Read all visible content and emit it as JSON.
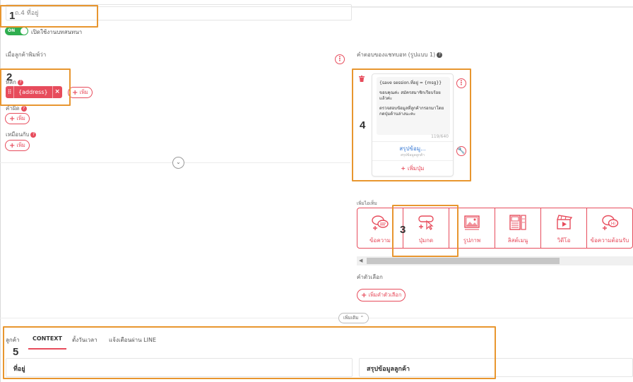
{
  "intent": {
    "name_value": "ถ.4 ที่อยู่",
    "toggle_state": "ON",
    "toggle_label": "เปิดใช้งานบทสนทนา"
  },
  "left": {
    "section_title": "เมื่อลูกค้าพิมพ์ว่า",
    "main_label": "หลัก",
    "chip_text": "{address}",
    "add_label": "เพิ่ม",
    "typo_label": "คำผิด",
    "similar_label": "เหมือนกับ"
  },
  "right": {
    "section_title": "คำตอบของแชทบอท (รูปแบบ 1)",
    "card": {
      "line1": "{save session.ที่อยู่ = {msg}}",
      "line2": "ขอบคุณค่ะ สมัครสมาชิกเรียบร้อยแล้วค่ะ",
      "line3": "ตรวจสอบข้อมูลที่ลูกค้ากรอกมาโดยกดปุ่มด้านล่างนะคะ",
      "counter": "119/640",
      "button_title": "สรุปข้อมู...",
      "button_sub": "สรุปข้อมูลลูกค้า",
      "add_button": "เพิ่มปุ่ม"
    },
    "add_more_label": "เพิ่มไอเท็ม",
    "types": [
      {
        "label": "ข้อความ",
        "icon": "message-icon"
      },
      {
        "label": "ปุ่มกด",
        "icon": "button-cursor-icon"
      },
      {
        "label": "รูปภาพ",
        "icon": "image-icon"
      },
      {
        "label": "ลิสต์เมนู",
        "icon": "list-menu-icon"
      },
      {
        "label": "วิดีโอ",
        "icon": "video-icon"
      },
      {
        "label": "ข้อความต้อนรับ",
        "icon": "greeting-icon"
      }
    ],
    "options_label": "คำตัวเลือก",
    "add_option": "เพิ่มคำตัวเลือก"
  },
  "more_button": "เพิ่มเติม",
  "tabs": {
    "items": [
      "ลูกค้า",
      "CONTEXT",
      "ตั้งวันเวลา",
      "แจ้งเตือนผ่าน LINE"
    ],
    "active_index": 1
  },
  "fields": {
    "address": "ที่อยู่",
    "summary": "สรุปข้อมูลลูกค้า"
  },
  "markers": [
    "1",
    "2",
    "3",
    "4",
    "5"
  ],
  "colors": {
    "accent": "#e74c5c",
    "annotation": "#e8962f",
    "toggle_on": "#2fae4f",
    "link": "#3a7bd5"
  }
}
